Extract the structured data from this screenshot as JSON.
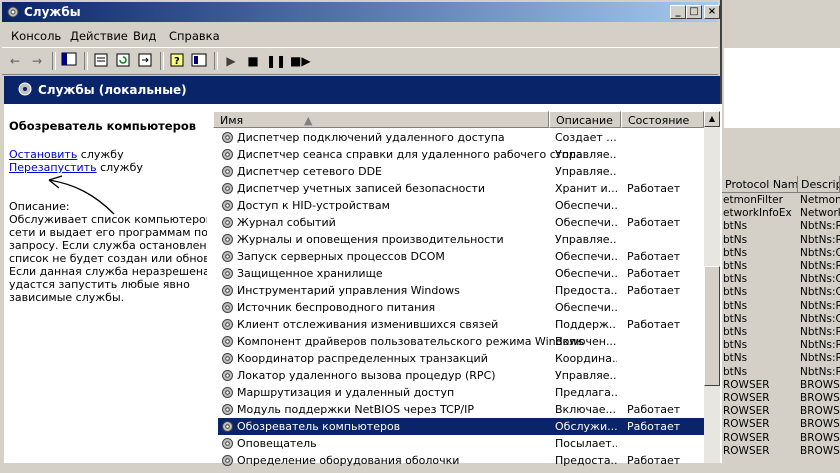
{
  "window": {
    "title": "Службы"
  },
  "menu": [
    "Консоль",
    "Действие",
    "Вид",
    "Справка"
  ],
  "banner": {
    "title": "Службы (локальные)"
  },
  "details": {
    "service_title": "Обозреватель компьютеров",
    "stop_link": "Остановить",
    "stop_rest": " службу",
    "restart_link": "Перезапустить",
    "restart_rest": " службу",
    "desc_label": "Описание:",
    "desc_lines": [
      "Обслуживает список компьютеров в",
      "сети и выдает его программам по",
      "запросу. Если служба остановлена,",
      "список не будет создан или обновлен.",
      "Если данная служба неразрешена, не",
      "удастся запустить любые явно",
      "зависимые службы."
    ]
  },
  "columns": {
    "name": "Имя",
    "desc": "Описание",
    "state": "Состояние"
  },
  "services": [
    {
      "name": "Диспетчер подключений удаленного доступа",
      "desc": "Создает ...",
      "state": ""
    },
    {
      "name": "Диспетчер сеанса справки для удаленного рабочего стола",
      "desc": "Управляе...",
      "state": ""
    },
    {
      "name": "Диспетчер сетевого DDE",
      "desc": "Управляе...",
      "state": ""
    },
    {
      "name": "Диспетчер учетных записей безопасности",
      "desc": "Хранит и...",
      "state": "Работает"
    },
    {
      "name": "Доступ к HID-устройствам",
      "desc": "Обеспечи...",
      "state": ""
    },
    {
      "name": "Журнал событий",
      "desc": "Обеспечи...",
      "state": "Работает"
    },
    {
      "name": "Журналы и оповещения производительности",
      "desc": "Управляе...",
      "state": ""
    },
    {
      "name": "Запуск серверных процессов DCOM",
      "desc": "Обеспечи...",
      "state": "Работает"
    },
    {
      "name": "Защищенное хранилище",
      "desc": "Обеспечи...",
      "state": "Работает"
    },
    {
      "name": "Инструментарий управления Windows",
      "desc": "Предоста...",
      "state": "Работает"
    },
    {
      "name": "Источник беспроводного питания",
      "desc": "Обеспечи...",
      "state": ""
    },
    {
      "name": "Клиент отслеживания изменившихся связей",
      "desc": "Поддерж...",
      "state": "Работает"
    },
    {
      "name": "Компонент драйверов пользовательского режима Windows",
      "desc": "Включен...",
      "state": ""
    },
    {
      "name": "Координатор распределенных транзакций",
      "desc": "Координа...",
      "state": ""
    },
    {
      "name": "Локатор удаленного вызова процедур (RPC)",
      "desc": "Управляе...",
      "state": ""
    },
    {
      "name": "Маршрутизация и удаленный доступ",
      "desc": "Предлага...",
      "state": ""
    },
    {
      "name": "Модуль поддержки NetBIOS через TCP/IP",
      "desc": "Включае...",
      "state": "Работает"
    },
    {
      "name": "Обозреватель компьютеров",
      "desc": "Обслужи...",
      "state": "Работает"
    },
    {
      "name": "Оповещатель",
      "desc": "Посылает...",
      "state": ""
    },
    {
      "name": "Определение оборудования оболочки",
      "desc": "Предоста...",
      "state": "Работает"
    }
  ],
  "selected_index": 17,
  "bg_window": {
    "headers": [
      "Protocol Name",
      "Descript"
    ],
    "rows": [
      [
        "etmonFilter",
        "NetmonF"
      ],
      [
        "etworkInfoEx",
        "Network"
      ],
      [
        "btNs",
        "NbtNs:R"
      ],
      [
        "btNs",
        "NbtNs:R"
      ],
      [
        "btNs",
        "NbtNs:Q"
      ],
      [
        "btNs",
        "NbtNs:R"
      ],
      [
        "btNs",
        "NbtNs:Q"
      ],
      [
        "btNs",
        "NbtNs:Q"
      ],
      [
        "btNs",
        "NbtNs:R"
      ],
      [
        "btNs",
        "NbtNs:Q"
      ],
      [
        "btNs",
        "NbtNs:R"
      ],
      [
        "btNs",
        "NbtNs:R"
      ],
      [
        "btNs",
        "NbtNs:R"
      ],
      [
        "btNs",
        "NbtNs:R"
      ],
      [
        "ROWSER",
        "BROWSE"
      ],
      [
        "ROWSER",
        "BROWSE"
      ],
      [
        "ROWSER",
        "BROWSE"
      ],
      [
        "ROWSER",
        "BROWSE"
      ],
      [
        "ROWSER",
        "BROWSE"
      ],
      [
        "ROWSER",
        "BROWSE"
      ]
    ]
  }
}
